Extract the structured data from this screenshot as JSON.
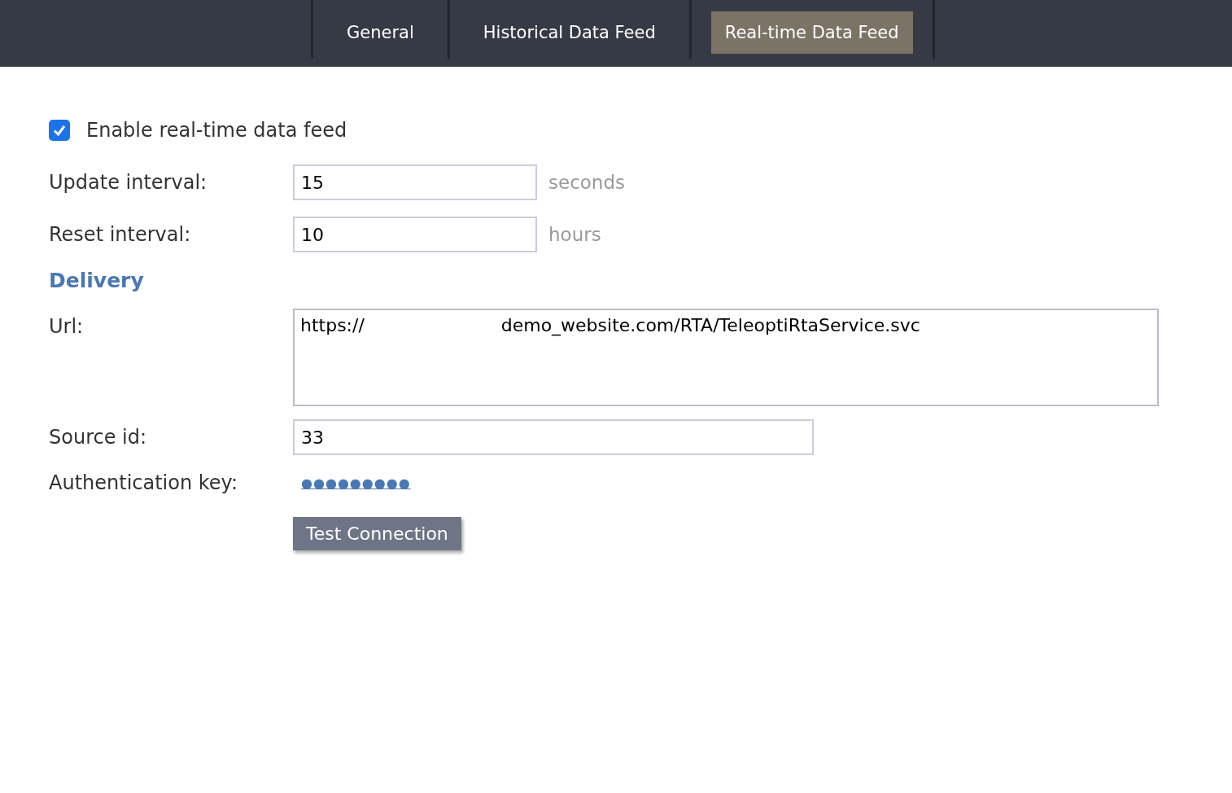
{
  "tabs": [
    {
      "label": "General",
      "selected": false
    },
    {
      "label": "Historical Data Feed",
      "selected": false
    },
    {
      "label": "Real-time Data Feed",
      "selected": true
    }
  ],
  "enable": {
    "label": "Enable real-time data feed",
    "checked": true
  },
  "intervals": [
    {
      "label": "Update interval:",
      "value": "15",
      "unit": "seconds"
    },
    {
      "label": "Reset interval:",
      "value": "10",
      "unit": "hours"
    }
  ],
  "delivery": {
    "heading": "Delivery",
    "url_label": "Url:",
    "url": "https://                        demo_website.com/RTA/TeleoptiRtaService.svc",
    "source_label": "Source id:",
    "source_id": "33",
    "auth_label": "Authentication key:",
    "auth_key": "●●●●●●●●●"
  },
  "button": "Test Connection"
}
